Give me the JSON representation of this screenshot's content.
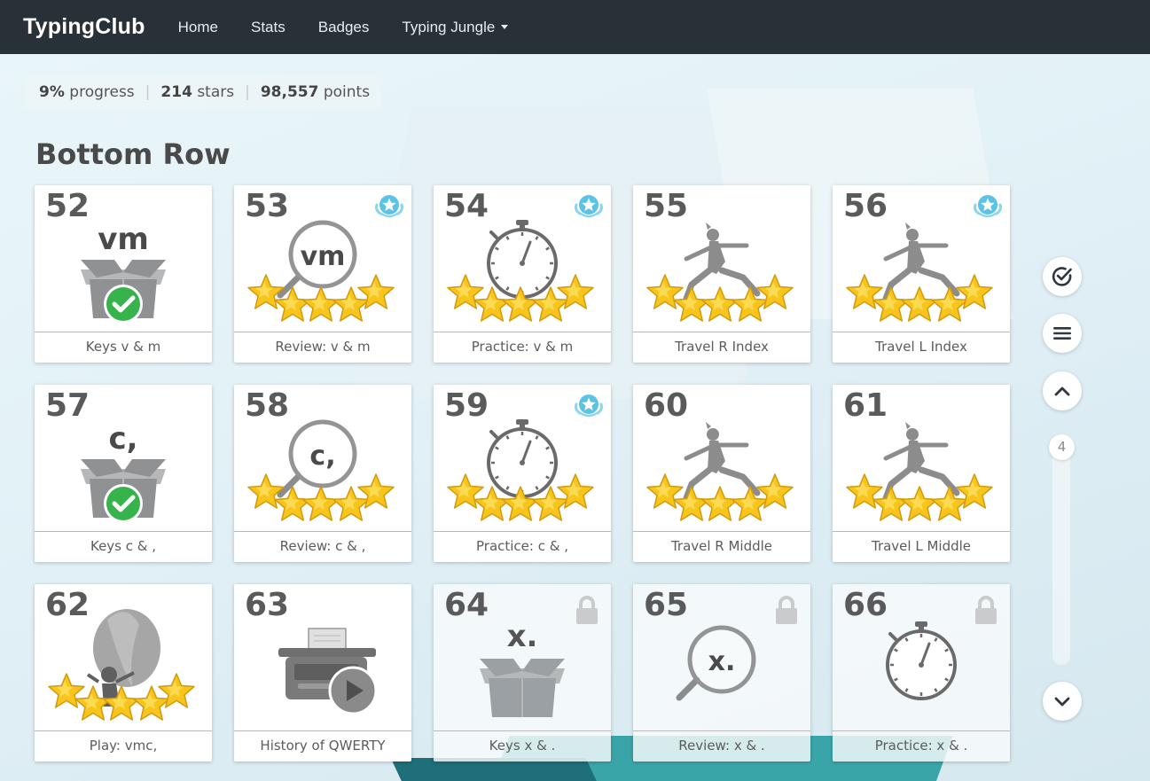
{
  "nav": {
    "brand": "TypingClub",
    "items": [
      "Home",
      "Stats",
      "Badges",
      "Typing Jungle"
    ]
  },
  "stats": {
    "progress_value": "9%",
    "progress_label": "progress",
    "stars_value": "214",
    "stars_label": "stars",
    "points_value": "98,557",
    "points_label": "points"
  },
  "section_title": "Bottom Row",
  "lessons": [
    {
      "num": "52",
      "label": "Keys v & m",
      "icon": "keys-box-icon",
      "keys": "vm",
      "status": "completed"
    },
    {
      "num": "53",
      "label": "Review: v & m",
      "icon": "review-magnifier-icon",
      "keys": "vm",
      "stars": 5,
      "badge": true
    },
    {
      "num": "54",
      "label": "Practice: v & m",
      "icon": "stopwatch-icon",
      "stars": 5,
      "badge": true
    },
    {
      "num": "55",
      "label": "Travel R Index",
      "icon": "yoga-pose-icon",
      "stars": 5
    },
    {
      "num": "56",
      "label": "Travel L Index",
      "icon": "yoga-pose-icon",
      "stars": 5,
      "badge": true
    },
    {
      "num": "57",
      "label": "Keys c & ,",
      "icon": "keys-box-icon",
      "keys": "c,",
      "status": "completed"
    },
    {
      "num": "58",
      "label": "Review: c & ,",
      "icon": "review-magnifier-icon",
      "keys": "c,",
      "stars": 5
    },
    {
      "num": "59",
      "label": "Practice: c & ,",
      "icon": "stopwatch-icon",
      "stars": 5,
      "badge": true
    },
    {
      "num": "60",
      "label": "Travel R Middle",
      "icon": "yoga-pose-icon",
      "stars": 5
    },
    {
      "num": "61",
      "label": "Travel L Middle",
      "icon": "yoga-pose-icon",
      "stars": 5
    },
    {
      "num": "62",
      "label": "Play: vmc,",
      "icon": "balloon-game-icon",
      "stars": 5
    },
    {
      "num": "63",
      "label": "History of QWERTY",
      "icon": "typewriter-video-icon"
    },
    {
      "num": "64",
      "label": "Keys x & .",
      "icon": "keys-box-icon",
      "keys": "x.",
      "locked": true
    },
    {
      "num": "65",
      "label": "Review: x & .",
      "icon": "review-magnifier-icon",
      "keys": "x.",
      "locked": true
    },
    {
      "num": "66",
      "label": "Practice: x & .",
      "icon": "stopwatch-icon",
      "locked": true
    }
  ],
  "controls": {
    "page_indicator": "4"
  },
  "colors": {
    "navbar": "#283038",
    "star": "#f5c518",
    "check": "#35b34a",
    "badge": "#5cc3e6"
  }
}
